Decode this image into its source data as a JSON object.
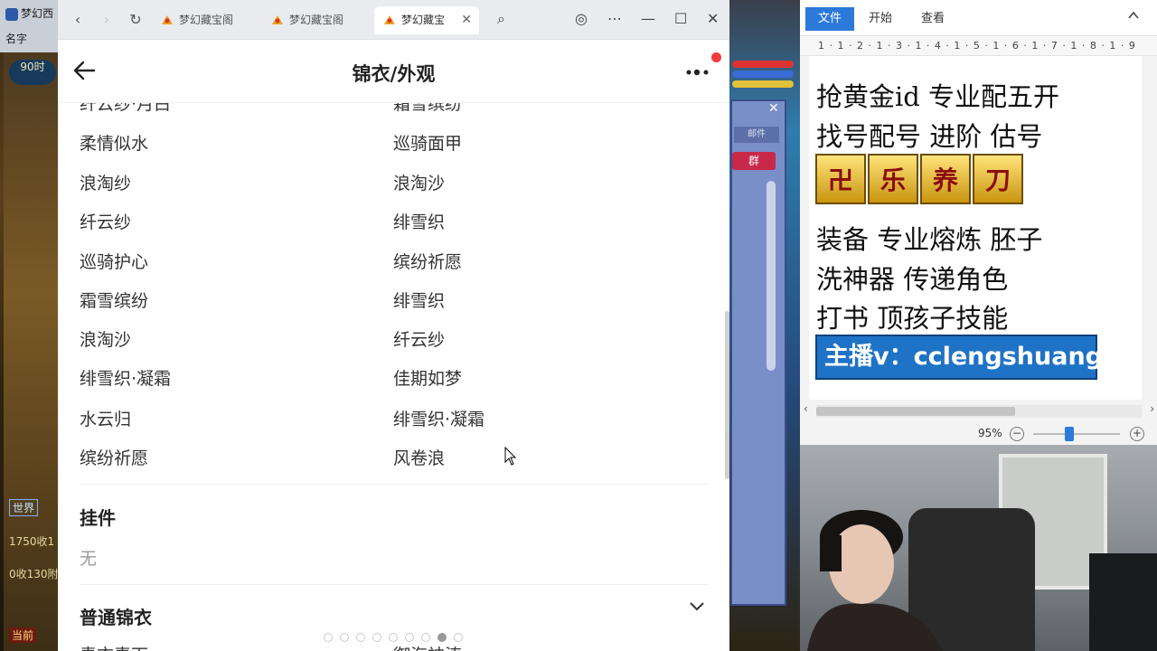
{
  "game": {
    "title": "梦幻西",
    "name_label": "名字",
    "time_label": "90时",
    "chat_world": "世界",
    "chat_line1": "1750收1",
    "chat_line2": "0收130附",
    "current_label": "当前",
    "group_button": "群",
    "panel_input": "邮件"
  },
  "browser": {
    "tabs": [
      {
        "label": "梦幻藏宝阁"
      },
      {
        "label": "梦幻藏宝阁"
      },
      {
        "label": "梦幻藏宝"
      }
    ]
  },
  "page": {
    "title": "锦衣/外观",
    "outfit_rows": [
      {
        "left": "纤云纱·月白",
        "right": "霜雪缤纷"
      },
      {
        "left": "柔情似水",
        "right": "巡骑面甲"
      },
      {
        "left": "浪淘纱",
        "right": "浪淘沙"
      },
      {
        "left": "纤云纱",
        "right": "绯雪织"
      },
      {
        "left": "巡骑护心",
        "right": "缤纷祈愿"
      },
      {
        "left": "霜雪缤纷",
        "right": "绯雪织"
      },
      {
        "left": "浪淘沙",
        "right": "纤云纱"
      },
      {
        "left": "绯雪织·凝霜",
        "right": "佳期如梦"
      },
      {
        "left": "水云归",
        "right": "绯雪织·凝霜"
      },
      {
        "left": "缤纷祈愿",
        "right": "风卷浪"
      }
    ],
    "pendant_title": "挂件",
    "pendant_value": "无",
    "normal_outfit_title": "普通锦衣",
    "next_row": {
      "left": "青衣素面",
      "right": "御海神涛"
    },
    "pager_total": 9,
    "pager_active": 7
  },
  "wordprocessor": {
    "tabs": [
      "文件",
      "开始",
      "查看"
    ],
    "ruler": "1 · 1 · 2 · 1 · 3 · 1 · 4 · 1 · 5 · 1 · 6 · 1 · 7 · 1 · 8 · 1 · 9",
    "lines": [
      "抢黄金id 专业配五开",
      "找号配号 进阶 估号",
      "装备 专业熔炼 胚子",
      "洗神器 传递角色",
      "打书 顶孩子技能"
    ],
    "emblems": [
      "卍",
      "乐",
      "养",
      "刀"
    ],
    "streamer": "主播v：cclengshuang",
    "zoom": "95%",
    "zoom_level": 0.42
  },
  "colors": {
    "accent": "#2b79d9",
    "notification": "#f43a3a",
    "streamer_bg": "#1f73c6"
  }
}
